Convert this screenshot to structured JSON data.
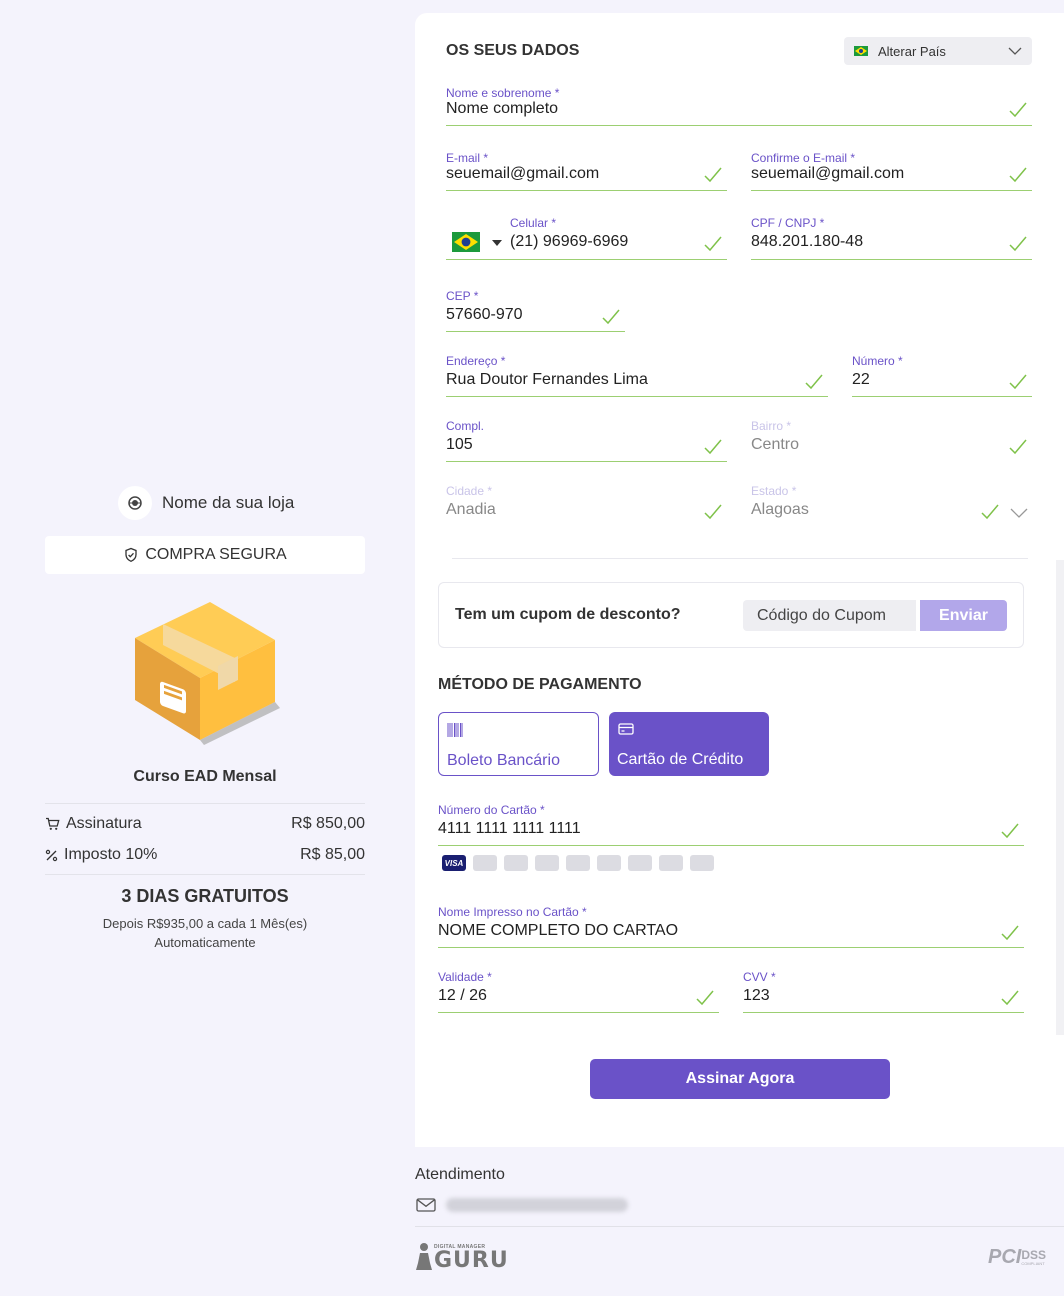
{
  "store": {
    "name": "Nome da sua loja",
    "secure_label": "COMPRA SEGURA"
  },
  "product": {
    "name": "Curso EAD Mensal",
    "lines": [
      {
        "label": "Assinatura",
        "value": "R$ 850,00"
      },
      {
        "label": "Imposto 10%",
        "value": "R$ 85,00"
      }
    ],
    "trial": "3 DIAS GRATUITOS",
    "after_line1": "Depois R$935,00 a cada 1 Mês(es)",
    "after_line2": "Automaticamente"
  },
  "form": {
    "title": "OS SEUS DADOS",
    "country_button": "Alterar País",
    "fields": {
      "nome": {
        "label": "Nome e sobrenome *",
        "value": "Nome completo"
      },
      "email": {
        "label": "E-mail *",
        "value": "seuemail@gmail.com"
      },
      "email_confirm": {
        "label": "Confirme o E-mail *",
        "value": "seuemail@gmail.com"
      },
      "celular": {
        "label": "Celular *",
        "value": "(21) 96969-6969"
      },
      "cpf": {
        "label": "CPF / CNPJ *",
        "value": "848.201.180-48"
      },
      "cep": {
        "label": "CEP *",
        "value": "57660-970"
      },
      "endereco": {
        "label": "Endereço *",
        "value": "Rua Doutor Fernandes Lima"
      },
      "numero": {
        "label": "Número *",
        "value": "22"
      },
      "compl": {
        "label": "Compl.",
        "value": "105"
      },
      "bairro": {
        "label": "Bairro *",
        "value": "Centro"
      },
      "cidade": {
        "label": "Cidade *",
        "value": "Anadia"
      },
      "estado": {
        "label": "Estado *",
        "value": "Alagoas"
      }
    }
  },
  "coupon": {
    "question": "Tem um cupom de desconto?",
    "placeholder": "Código do Cupom",
    "button": "Enviar"
  },
  "payment": {
    "title": "MÉTODO DE PAGAMENTO",
    "methods": [
      {
        "label": "Boleto Bancário",
        "icon": "barcode-icon",
        "selected": false
      },
      {
        "label": "Cartão de Crédito",
        "icon": "credit-card-icon",
        "selected": true
      }
    ],
    "card_number": {
      "label": "Número do Cartão *",
      "value": "4111 1111 1111 1111"
    },
    "brand_visa": "VISA",
    "card_name": {
      "label": "Nome Impresso no Cartão *",
      "value": "NOME COMPLETO DO CARTAO"
    },
    "validity": {
      "label": "Validade *",
      "value": "12 / 26"
    },
    "cvv": {
      "label": "CVV *",
      "value": "123"
    },
    "submit": "Assinar Agora"
  },
  "footer": {
    "support_title": "Atendimento",
    "guru_small": "DIGITAL MANAGER",
    "guru_big": "GURU",
    "pci_big": "PCI",
    "pci_dss": "DSS",
    "pci_small": "COMPLIANT"
  },
  "colors": {
    "accent": "#6a52c8",
    "valid": "#9ccf72",
    "background": "#f4f3fc"
  }
}
